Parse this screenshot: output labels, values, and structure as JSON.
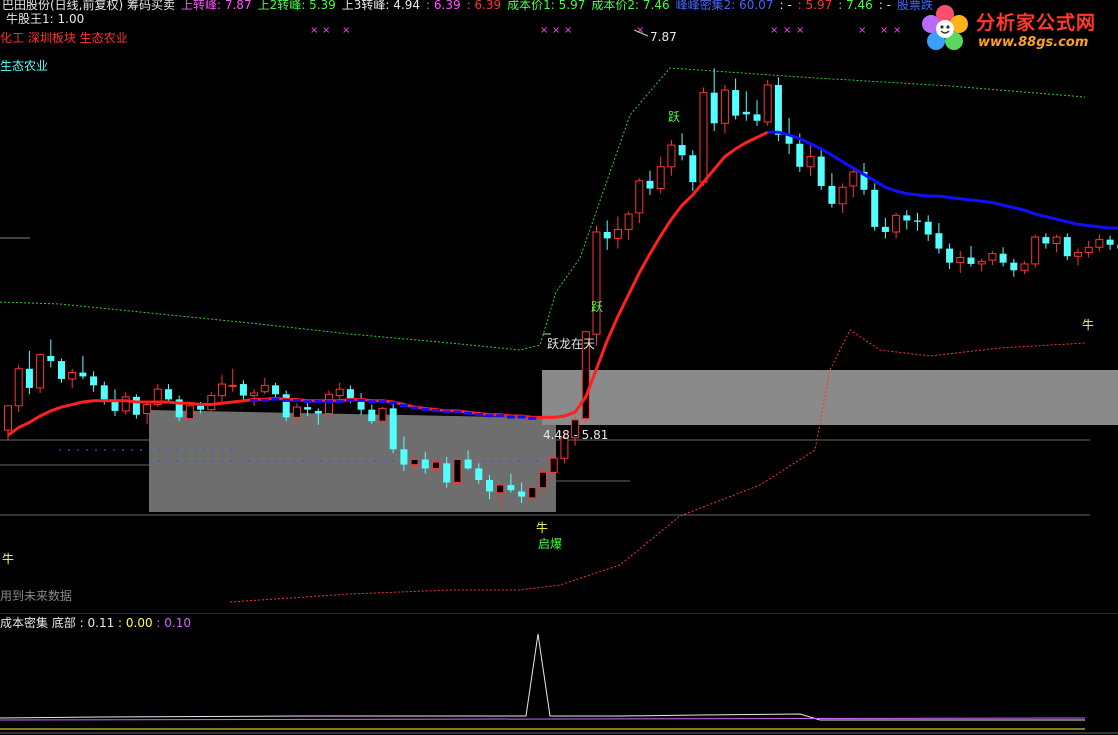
{
  "header": {
    "line1": [
      {
        "text": "巴田股份(日线,前复权) 筹码买卖",
        "color": "#e8e8e8"
      },
      {
        "text": "上转峰: 7.87",
        "color": "#ff55ff"
      },
      {
        "text": "上2转峰: 5.39",
        "color": "#44ff44"
      },
      {
        "text": "上3转峰: 4.94",
        "color": "#e8e8e8"
      },
      {
        "text": ": 6.39",
        "color": "#ff55ff"
      },
      {
        "text": ": 6.39",
        "color": "#ff3333"
      },
      {
        "text": "成本价1: 5.97",
        "color": "#44ff44"
      },
      {
        "text": "成本价2: 7.46",
        "color": "#44ff44"
      },
      {
        "text": "峰峰密集2: 60.07",
        "color": "#4466ff"
      },
      {
        "text": ": -",
        "color": "#e8e8e8"
      },
      {
        "text": ": 5.97",
        "color": "#ff3333"
      },
      {
        "text": ": 7.46",
        "color": "#44ff44"
      },
      {
        "text": ": -",
        "color": "#e8e8e8"
      },
      {
        "text": "股票跌",
        "color": "#4466ff"
      }
    ],
    "niu_label": "牛股王1: 1.00",
    "sector": "化工 深圳板块 生态农业",
    "concept": "生态农业",
    "future_note": "用到未来数据"
  },
  "logo": {
    "text": "分析家公式网",
    "url": "www.88gs.com"
  },
  "sub_header": {
    "name": "成本密集 底部",
    "values": [
      {
        "text": ": 0.11",
        "color": "#e8e8e8"
      },
      {
        "text": ": 0.00",
        "color": "#ffff44"
      },
      {
        "text": ": 0.10",
        "color": "#cc66ff"
      }
    ]
  },
  "annotations": {
    "peak_price": "7.87",
    "price_range": "4.48 - 5.81",
    "niu_start": "牛",
    "niu_mid": "牛",
    "niu_end": "牛",
    "qibao": "启爆",
    "yue1": "跃",
    "yue2": "跃",
    "yuelong": "跃龙在天"
  },
  "colors": {
    "bull": "#ff3333",
    "bear": "#54ffff",
    "ma_red": "#ff2020",
    "ma_blue": "#1010ff",
    "green_dots": "#33cc33",
    "red_dots": "#ff3333",
    "cost_box": "#777777",
    "separator": "#8a0010"
  },
  "chart_data": {
    "type": "candlestick",
    "price_range": [
      3.75,
      8.17
    ],
    "candles": [
      [
        5.04,
        5.23,
        4.96,
        5.23
      ],
      [
        5.23,
        5.55,
        5.18,
        5.52
      ],
      [
        5.52,
        5.66,
        5.32,
        5.37
      ],
      [
        5.37,
        5.64,
        5.33,
        5.63
      ],
      [
        5.62,
        5.75,
        5.53,
        5.58
      ],
      [
        5.58,
        5.6,
        5.41,
        5.44
      ],
      [
        5.44,
        5.52,
        5.37,
        5.49
      ],
      [
        5.49,
        5.62,
        5.44,
        5.46
      ],
      [
        5.46,
        5.5,
        5.34,
        5.39
      ],
      [
        5.39,
        5.42,
        5.24,
        5.28
      ],
      [
        5.28,
        5.36,
        5.15,
        5.19
      ],
      [
        5.19,
        5.34,
        5.16,
        5.3
      ],
      [
        5.3,
        5.32,
        5.13,
        5.16
      ],
      [
        5.17,
        5.26,
        5.09,
        5.24
      ],
      [
        5.24,
        5.4,
        5.22,
        5.36
      ],
      [
        5.36,
        5.4,
        5.26,
        5.28
      ],
      [
        5.28,
        5.31,
        5.11,
        5.14
      ],
      [
        5.13,
        5.25,
        5.12,
        5.23
      ],
      [
        5.23,
        5.26,
        5.17,
        5.2
      ],
      [
        5.2,
        5.34,
        5.19,
        5.31
      ],
      [
        5.31,
        5.47,
        5.25,
        5.4
      ],
      [
        5.39,
        5.52,
        5.34,
        5.39
      ],
      [
        5.4,
        5.43,
        5.28,
        5.31
      ],
      [
        5.31,
        5.36,
        5.23,
        5.33
      ],
      [
        5.34,
        5.45,
        5.32,
        5.39
      ],
      [
        5.39,
        5.41,
        5.29,
        5.32
      ],
      [
        5.32,
        5.35,
        5.11,
        5.14
      ],
      [
        5.14,
        5.25,
        5.09,
        5.22
      ],
      [
        5.22,
        5.27,
        5.15,
        5.2
      ],
      [
        5.19,
        5.21,
        5.08,
        5.17
      ],
      [
        5.17,
        5.35,
        5.13,
        5.32
      ],
      [
        5.31,
        5.41,
        5.27,
        5.36
      ],
      [
        5.36,
        5.39,
        5.25,
        5.29
      ],
      [
        5.29,
        5.33,
        5.16,
        5.2
      ],
      [
        5.2,
        5.24,
        5.09,
        5.11
      ],
      [
        5.11,
        5.22,
        5.09,
        5.21
      ],
      [
        5.21,
        5.27,
        4.86,
        4.89
      ],
      [
        4.89,
        4.99,
        4.72,
        4.77
      ],
      [
        4.77,
        4.86,
        4.71,
        4.81
      ],
      [
        4.81,
        4.87,
        4.7,
        4.74
      ],
      [
        4.74,
        4.82,
        4.7,
        4.79
      ],
      [
        4.78,
        4.83,
        4.59,
        4.63
      ],
      [
        4.63,
        4.83,
        4.6,
        4.81
      ],
      [
        4.81,
        4.88,
        4.73,
        4.74
      ],
      [
        4.74,
        4.78,
        4.62,
        4.65
      ],
      [
        4.65,
        4.69,
        4.5,
        4.56
      ],
      [
        4.55,
        4.62,
        4.45,
        4.61
      ],
      [
        4.61,
        4.7,
        4.55,
        4.57
      ],
      [
        4.56,
        4.63,
        4.47,
        4.52
      ],
      [
        4.51,
        4.61,
        4.5,
        4.59
      ],
      [
        4.59,
        4.75,
        4.54,
        4.71
      ],
      [
        4.71,
        4.85,
        4.66,
        4.82
      ],
      [
        4.82,
        5.02,
        4.78,
        4.98
      ],
      [
        4.98,
        5.15,
        4.92,
        5.12
      ],
      [
        5.13,
        5.81,
        5.1,
        5.81
      ],
      [
        5.79,
        6.64,
        5.7,
        6.59
      ],
      [
        6.59,
        6.68,
        6.45,
        6.54
      ],
      [
        6.54,
        6.71,
        6.46,
        6.61
      ],
      [
        6.61,
        6.75,
        6.53,
        6.73
      ],
      [
        6.74,
        7.01,
        6.66,
        6.99
      ],
      [
        6.99,
        7.07,
        6.88,
        6.93
      ],
      [
        6.93,
        7.18,
        6.89,
        7.1
      ],
      [
        7.1,
        7.31,
        7.03,
        7.27
      ],
      [
        7.27,
        7.36,
        7.15,
        7.19
      ],
      [
        7.19,
        7.23,
        6.91,
        6.98
      ],
      [
        6.98,
        7.72,
        6.95,
        7.68
      ],
      [
        7.68,
        7.87,
        7.38,
        7.44
      ],
      [
        7.44,
        7.74,
        7.36,
        7.7
      ],
      [
        7.7,
        7.79,
        7.47,
        7.5
      ],
      [
        7.53,
        7.69,
        7.46,
        7.51
      ],
      [
        7.51,
        7.62,
        7.42,
        7.46
      ],
      [
        7.45,
        7.78,
        7.42,
        7.74
      ],
      [
        7.74,
        7.8,
        7.3,
        7.35
      ],
      [
        7.35,
        7.48,
        7.2,
        7.28
      ],
      [
        7.28,
        7.36,
        7.06,
        7.1
      ],
      [
        7.1,
        7.28,
        7.03,
        7.18
      ],
      [
        7.18,
        7.23,
        6.92,
        6.95
      ],
      [
        6.95,
        7.05,
        6.78,
        6.81
      ],
      [
        6.81,
        6.97,
        6.74,
        6.94
      ],
      [
        6.95,
        7.08,
        6.86,
        7.06
      ],
      [
        7.06,
        7.13,
        6.88,
        6.92
      ],
      [
        6.92,
        6.97,
        6.6,
        6.63
      ],
      [
        6.63,
        6.7,
        6.54,
        6.59
      ],
      [
        6.59,
        6.74,
        6.54,
        6.72
      ],
      [
        6.72,
        6.76,
        6.61,
        6.68
      ],
      [
        6.68,
        6.74,
        6.6,
        6.67
      ],
      [
        6.67,
        6.72,
        6.52,
        6.57
      ],
      [
        6.58,
        6.66,
        6.42,
        6.46
      ],
      [
        6.46,
        6.5,
        6.3,
        6.35
      ],
      [
        6.35,
        6.44,
        6.27,
        6.39
      ],
      [
        6.39,
        6.48,
        6.32,
        6.34
      ],
      [
        6.34,
        6.38,
        6.28,
        6.36
      ],
      [
        6.37,
        6.44,
        6.33,
        6.42
      ],
      [
        6.42,
        6.47,
        6.32,
        6.35
      ],
      [
        6.35,
        6.38,
        6.24,
        6.29
      ],
      [
        6.29,
        6.36,
        6.26,
        6.34
      ],
      [
        6.34,
        6.57,
        6.31,
        6.55
      ],
      [
        6.55,
        6.58,
        6.46,
        6.5
      ],
      [
        6.5,
        6.57,
        6.43,
        6.55
      ],
      [
        6.55,
        6.58,
        6.37,
        6.4
      ],
      [
        6.4,
        6.46,
        6.33,
        6.43
      ],
      [
        6.43,
        6.52,
        6.39,
        6.47
      ],
      [
        6.47,
        6.57,
        6.44,
        6.53
      ],
      [
        6.53,
        6.56,
        6.45,
        6.49
      ],
      [
        6.49,
        6.52,
        6.43,
        6.46
      ],
      [
        6.46,
        6.49,
        6.37,
        6.41
      ],
      [
        6.41,
        6.45,
        6.33,
        6.36
      ],
      [
        6.36,
        6.76,
        6.34,
        6.74
      ]
    ],
    "series": [
      {
        "type": "line",
        "color": "#ff2020",
        "values": [
          5.0,
          5.06,
          5.1,
          5.15,
          5.19,
          5.22,
          5.24,
          5.26,
          5.27,
          5.27,
          5.27,
          5.27,
          5.26,
          5.26,
          5.26,
          5.26,
          5.25,
          5.25,
          5.24,
          5.24,
          5.25,
          5.26,
          5.27,
          5.28,
          5.28,
          5.29,
          5.28,
          5.28,
          5.27,
          5.27,
          5.27,
          5.27,
          5.28,
          5.28,
          5.27,
          5.27,
          5.26,
          5.24,
          5.22,
          5.21,
          5.2,
          5.19,
          5.19,
          5.18,
          5.17,
          5.16,
          5.16,
          5.15,
          5.15,
          5.14,
          5.14,
          5.14,
          5.15,
          5.18,
          5.3,
          5.52,
          5.74,
          5.93,
          6.1,
          6.27,
          6.42,
          6.56,
          6.69,
          6.8,
          6.88,
          6.98,
          7.08,
          7.18,
          7.24,
          7.29,
          7.33,
          7.37
        ]
      },
      {
        "type": "line",
        "color": "#1010ff",
        "values": [
          7.37,
          7.37,
          7.35,
          7.32,
          7.28,
          7.24,
          7.19,
          7.14,
          7.09,
          7.04,
          6.99,
          6.94,
          6.91,
          6.89,
          6.88,
          6.87,
          6.87,
          6.86,
          6.85,
          6.84,
          6.83,
          6.82,
          6.8,
          6.78,
          6.76,
          6.73,
          6.71,
          6.69,
          6.67,
          6.65,
          6.64,
          6.63,
          6.62,
          6.62,
          6.61,
          6.6,
          6.6,
          6.59
        ]
      }
    ]
  }
}
